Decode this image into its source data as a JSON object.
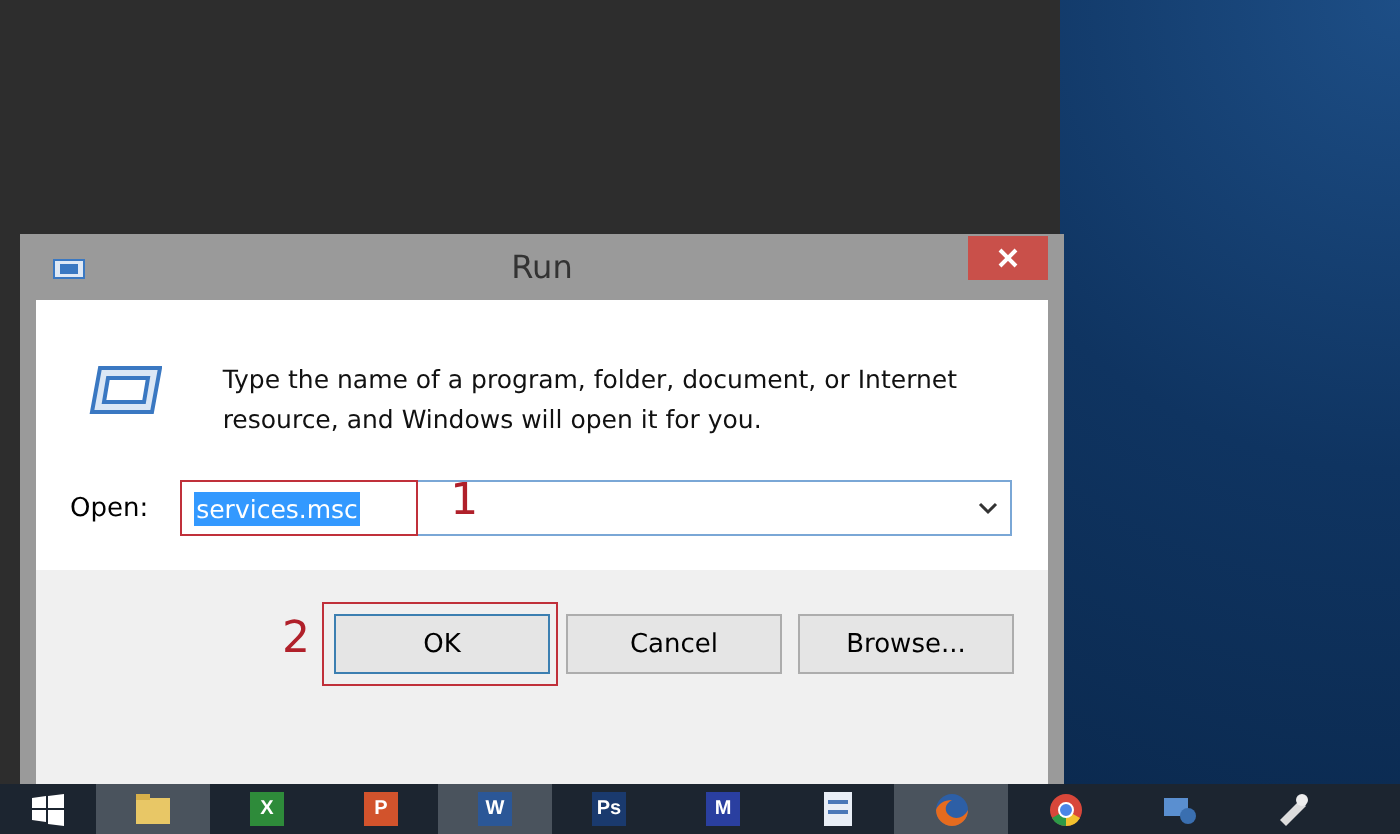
{
  "window": {
    "title": "Run"
  },
  "description": "Type the name of a program, folder, document, or Internet resource, and Windows will open it for you.",
  "open_field": {
    "label": "Open:",
    "value": "services.msc",
    "selected": true
  },
  "annotations": [
    {
      "number": "1"
    },
    {
      "number": "2"
    }
  ],
  "buttons": [
    {
      "label": "OK",
      "default": true
    },
    {
      "label": "Cancel",
      "default": false
    },
    {
      "label": "Browse...",
      "default": false
    }
  ],
  "taskbar": [
    {
      "kind": "folder",
      "active": true
    },
    {
      "kind": "letter",
      "label": "X",
      "color": "#2e8b3a",
      "active": false
    },
    {
      "kind": "letter",
      "label": "P",
      "color": "#d2532c",
      "active": false
    },
    {
      "kind": "letter",
      "label": "W",
      "color": "#2b5797",
      "active": true
    },
    {
      "kind": "letter",
      "label": "Ps",
      "color": "#1a3a6e",
      "active": false
    },
    {
      "kind": "letter",
      "label": "M",
      "color": "#2a3fa0",
      "active": false
    },
    {
      "kind": "doc",
      "active": false
    },
    {
      "kind": "fox",
      "active": true
    },
    {
      "kind": "chrome",
      "active": false
    },
    {
      "kind": "network",
      "active": false
    },
    {
      "kind": "tool",
      "active": false
    }
  ]
}
